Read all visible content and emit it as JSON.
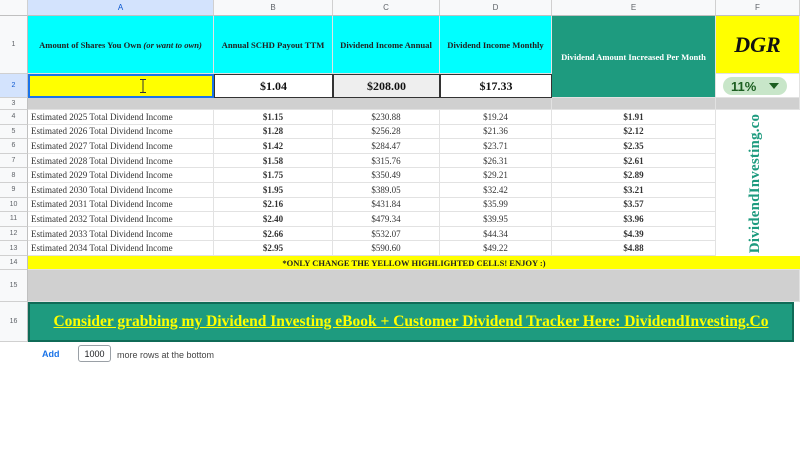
{
  "columns": [
    "A",
    "B",
    "C",
    "D",
    "E",
    "F"
  ],
  "row_numbers": [
    "1",
    "2",
    "3",
    "4",
    "5",
    "6",
    "7",
    "8",
    "9",
    "10",
    "11",
    "12",
    "13",
    "14",
    "15",
    "16"
  ],
  "header": {
    "shares_prefix": "Amount of Shares You Own ",
    "shares_italic": "(or want to own)",
    "payout": "Annual SCHD Payout TTM",
    "income_annual": "Dividend Income Annual",
    "income_monthly": "Dividend Income Monthly",
    "increase": "Dividend Amount Increased Per Month",
    "dgr": "DGR"
  },
  "inputs": {
    "shares_value": "",
    "payout": "$1.04",
    "income_annual": "$208.00",
    "income_monthly": "$17.33",
    "dgr_selected": "11%"
  },
  "rows": [
    {
      "label": "Estimated 2025 Total Dividend Income",
      "payout": "$1.15",
      "annual": "$230.88",
      "monthly": "$19.24",
      "increase": "$1.91"
    },
    {
      "label": "Estimated 2026 Total Dividend Income",
      "payout": "$1.28",
      "annual": "$256.28",
      "monthly": "$21.36",
      "increase": "$2.12"
    },
    {
      "label": "Estimated 2027 Total Dividend Income",
      "payout": "$1.42",
      "annual": "$284.47",
      "monthly": "$23.71",
      "increase": "$2.35"
    },
    {
      "label": "Estimated 2028 Total Dividend Income",
      "payout": "$1.58",
      "annual": "$315.76",
      "monthly": "$26.31",
      "increase": "$2.61"
    },
    {
      "label": "Estimated 2029 Total Dividend Income",
      "payout": "$1.75",
      "annual": "$350.49",
      "monthly": "$29.21",
      "increase": "$2.89"
    },
    {
      "label": "Estimated 2030 Total Dividend Income",
      "payout": "$1.95",
      "annual": "$389.05",
      "monthly": "$32.42",
      "increase": "$3.21"
    },
    {
      "label": "Estimated 2031 Total Dividend Income",
      "payout": "$2.16",
      "annual": "$431.84",
      "monthly": "$35.99",
      "increase": "$3.57"
    },
    {
      "label": "Estimated 2032 Total Dividend Income",
      "payout": "$2.40",
      "annual": "$479.34",
      "monthly": "$39.95",
      "increase": "$3.96"
    },
    {
      "label": "Estimated 2033 Total Dividend Income",
      "payout": "$2.66",
      "annual": "$532.07",
      "monthly": "$44.34",
      "increase": "$4.39"
    },
    {
      "label": "Estimated 2034 Total Dividend Income",
      "payout": "$2.95",
      "annual": "$590.60",
      "monthly": "$49.22",
      "increase": "$4.88"
    }
  ],
  "brand_vertical": "DividendInvesting.co",
  "note": "*ONLY CHANGE THE YELLOW HIGHLIGHTED CELLS! ENJOY :)",
  "promo": "Consider grabbing my Dividend Investing eBook + Customer Dividend Tracker Here: DividendInvesting.Co",
  "footer": {
    "add_label": "Add",
    "rows_count": "1000",
    "rows_suffix": "more rows at the bottom"
  },
  "colors": {
    "cyan": "#00ffff",
    "green": "#1e9b7f",
    "yellow": "#ffff00",
    "selection": "#1a73e8"
  }
}
